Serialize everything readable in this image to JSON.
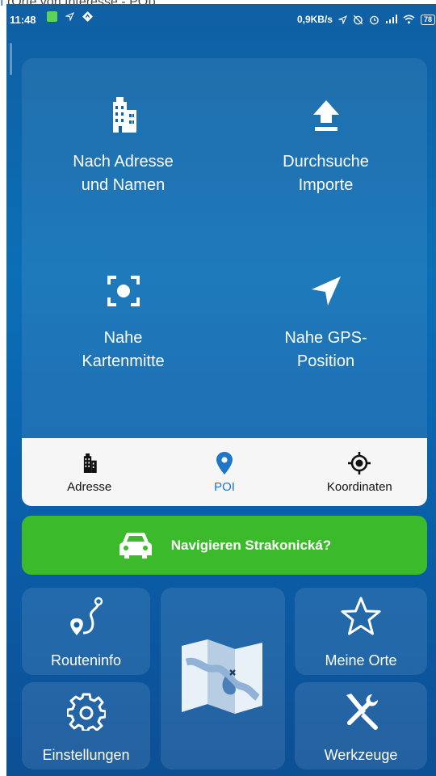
{
  "top_caption": {
    "prefix": "I",
    "text": "(Orte von Interesse - POI)."
  },
  "status_bar": {
    "time": "11:48",
    "network_speed": "0,9KB/s",
    "battery": "78"
  },
  "search_options": [
    {
      "label": "Nach Adresse\nund Namen",
      "icon": "building-icon"
    },
    {
      "label": "Durchsuche\nImporte",
      "icon": "upload-icon"
    },
    {
      "label": "Nahe\nKartenmitte",
      "icon": "map-center-icon"
    },
    {
      "label": "Nahe GPS-\nPosition",
      "icon": "navigation-arrow-icon"
    }
  ],
  "tabs": [
    {
      "label": "Adresse",
      "icon": "building-icon"
    },
    {
      "label": "POI",
      "icon": "location-pin-icon",
      "active": true
    },
    {
      "label": "Koordinaten",
      "icon": "crosshair-icon"
    }
  ],
  "navigate_button": {
    "label": "Navigieren Strakonická?",
    "icon": "car-icon"
  },
  "tiles": {
    "route_info": "Routeninfo",
    "settings": "Einstellungen",
    "my_places": "Meine Orte",
    "tools": "Werkzeuge",
    "map_icon": "map-icon"
  },
  "colors": {
    "background_top": "#0f5fa3",
    "accent_blue": "#1d76c8",
    "navigate_green": "#3bbb2b"
  }
}
